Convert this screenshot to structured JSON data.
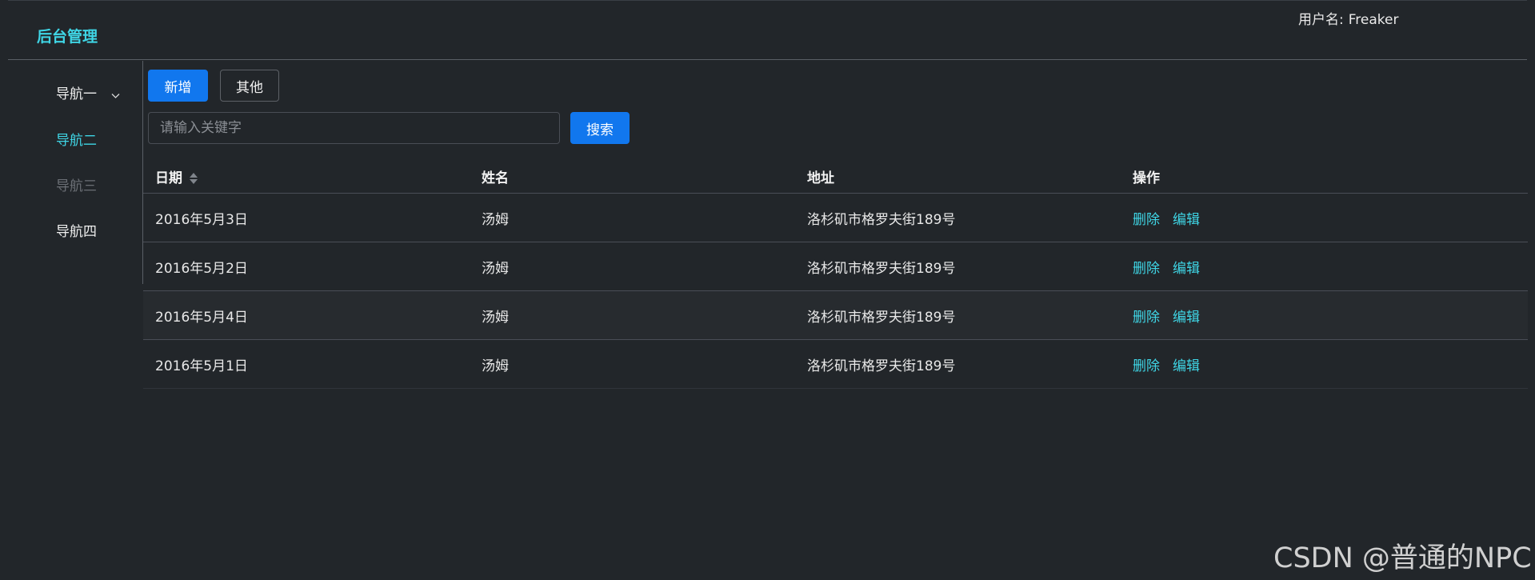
{
  "header": {
    "brand": "后台管理",
    "user_label": "用户名:",
    "user_name": "Freaker"
  },
  "sidebar": {
    "items": [
      {
        "label": "导航一",
        "state": "expandable"
      },
      {
        "label": "导航二",
        "state": "active"
      },
      {
        "label": "导航三",
        "state": "disabled"
      },
      {
        "label": "导航四",
        "state": "normal"
      }
    ]
  },
  "toolbar": {
    "add_label": "新增",
    "other_label": "其他",
    "search_placeholder": "请输入关键字",
    "search_value": "",
    "search_label": "搜索"
  },
  "table": {
    "columns": [
      "日期",
      "姓名",
      "地址",
      "操作"
    ],
    "rows": [
      {
        "date": "2016年5月3日",
        "name": "汤姆",
        "address": "洛杉矶市格罗夫街189号"
      },
      {
        "date": "2016年5月2日",
        "name": "汤姆",
        "address": "洛杉矶市格罗夫街189号"
      },
      {
        "date": "2016年5月4日",
        "name": "汤姆",
        "address": "洛杉矶市格罗夫街189号"
      },
      {
        "date": "2016年5月1日",
        "name": "汤姆",
        "address": "洛杉矶市格罗夫街189号"
      }
    ],
    "actions": {
      "delete": "删除",
      "edit": "编辑"
    }
  },
  "watermark": "CSDN @普通的NPC",
  "colors": {
    "background": "#22262a",
    "accent": "#3fd6e6",
    "primary": "#1177ee"
  }
}
